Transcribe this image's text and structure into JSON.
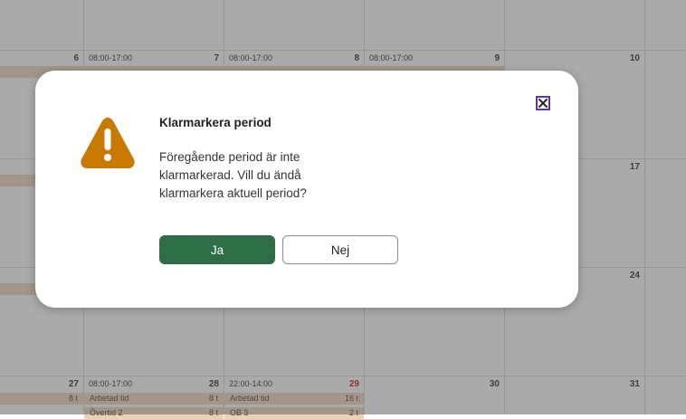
{
  "calendar": {
    "day_numbers": [
      "6",
      "7",
      "8",
      "9",
      "10",
      "17",
      "24",
      "27",
      "28",
      "29",
      "30",
      "31"
    ],
    "shifts": [
      "08:00-17:00",
      "08:00-17:00",
      "08:00-17:00",
      "08:00-17:00",
      "22:00-14:00"
    ],
    "entries": [
      {
        "label": "",
        "value": "8 t"
      },
      {
        "label": "Arbetad tid",
        "value": "8 t"
      },
      {
        "label": "Arbetad tid",
        "value": "16 t"
      },
      {
        "label": "Övertid 2",
        "value": "8 t"
      },
      {
        "label": "OB 3",
        "value": "2 t"
      }
    ],
    "holiday_color": "#c00000"
  },
  "dialog": {
    "title": "Klarmarkera period",
    "message": "Föregående period är inte klarmarkerad. Vill du ändå klarmarkera aktuell period?",
    "yes_label": "Ja",
    "no_label": "Nej",
    "icon": "warning-icon",
    "close_icon": "close-icon",
    "primary_color": "#2e6e47",
    "warning_color": "#c87a00"
  }
}
